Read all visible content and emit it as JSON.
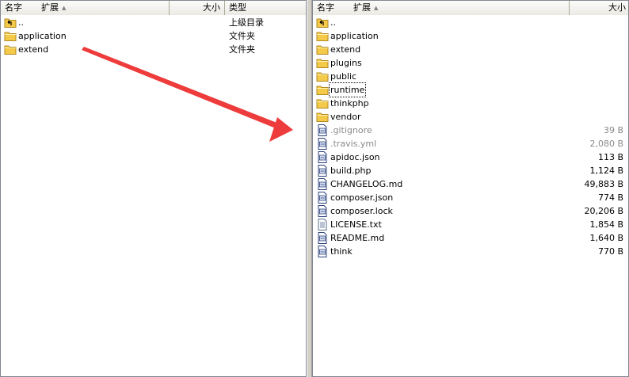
{
  "left": {
    "header": {
      "name": "名字",
      "ext": "扩展",
      "size": "大小",
      "type": "类型"
    },
    "items": [
      {
        "name": "..",
        "type": "上级目录",
        "icon": "up-folder-icon"
      },
      {
        "name": "application",
        "type": "文件夹",
        "icon": "folder-icon"
      },
      {
        "name": "extend",
        "type": "文件夹",
        "icon": "folder-icon"
      }
    ]
  },
  "right": {
    "header": {
      "name": "名字",
      "ext": "扩展",
      "size": "大小"
    },
    "items": [
      {
        "name": "..",
        "size": "",
        "icon": "up-folder-icon"
      },
      {
        "name": "application",
        "size": "",
        "icon": "folder-icon"
      },
      {
        "name": "extend",
        "size": "",
        "icon": "folder-icon"
      },
      {
        "name": "plugins",
        "size": "",
        "icon": "folder-icon"
      },
      {
        "name": "public",
        "size": "",
        "icon": "folder-icon"
      },
      {
        "name": "runtime",
        "size": "",
        "icon": "folder-icon",
        "focused": true
      },
      {
        "name": "thinkphp",
        "size": "",
        "icon": "folder-icon"
      },
      {
        "name": "vendor",
        "size": "",
        "icon": "folder-icon"
      },
      {
        "name": ".gitignore",
        "size": "39 B",
        "icon": "file-icon",
        "hidden": true
      },
      {
        "name": ".travis.yml",
        "size": "2,080 B",
        "icon": "file-icon",
        "hidden": true
      },
      {
        "name": "apidoc.json",
        "size": "113 B",
        "icon": "file-icon"
      },
      {
        "name": "build.php",
        "size": "1,124 B",
        "icon": "file-icon"
      },
      {
        "name": "CHANGELOG.md",
        "size": "49,883 B",
        "icon": "file-icon"
      },
      {
        "name": "composer.json",
        "size": "774 B",
        "icon": "file-icon"
      },
      {
        "name": "composer.lock",
        "size": "20,206 B",
        "icon": "file-icon"
      },
      {
        "name": "LICENSE.txt",
        "size": "1,854 B",
        "icon": "text-file-icon"
      },
      {
        "name": "README.md",
        "size": "1,640 B",
        "icon": "file-icon"
      },
      {
        "name": "think",
        "size": "770 B",
        "icon": "file-icon"
      }
    ]
  },
  "colors": {
    "arrow": "#ee3b3b",
    "folder": "#f5c949",
    "selection_text": "#000000"
  }
}
